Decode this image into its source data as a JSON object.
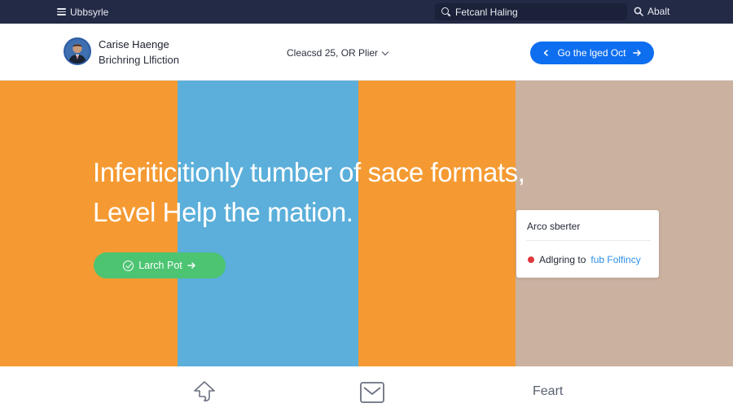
{
  "topbar": {
    "menu_label": "Ubbsyrle",
    "search_value": "Fetcanl Haling",
    "about_label": "Abalt"
  },
  "header": {
    "profile_name": "Carise Haenge",
    "profile_subtitle": "Brichring Llfiction",
    "filter_label": "Cleacsd 25, OR Plier",
    "cta_label": "Go the lged Oct"
  },
  "hero": {
    "headline_line1": "Inferiticitionly tumber of sace formats,",
    "headline_line2": "Level Help the mation.",
    "button_label": "Larch Pot",
    "stripe_colors": [
      "#f59a32",
      "#5bafda",
      "#f59a32",
      "#cbb1a0"
    ]
  },
  "card": {
    "title": "Arco sberter",
    "row_text": "Adlgring to",
    "row_link": "fub Folfincy",
    "status_color": "#e0393e"
  },
  "bottom_nav": {
    "items": [
      {
        "icon": "share-arrow-icon"
      },
      {
        "icon": "mail-icon"
      },
      {
        "label": "Feart"
      }
    ]
  },
  "colors": {
    "topbar_bg": "#232a45",
    "accent_blue": "#0e6ef0",
    "accent_green": "#4cc472"
  }
}
